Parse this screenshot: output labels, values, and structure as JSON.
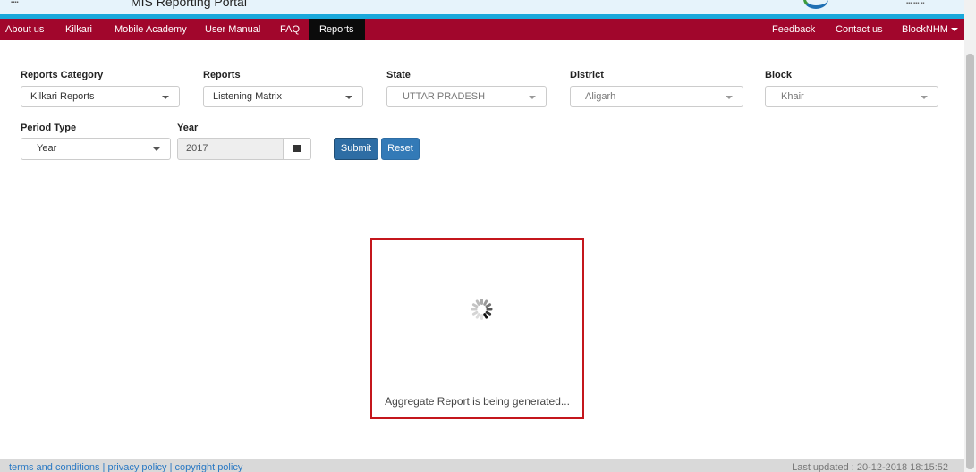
{
  "header": {
    "portal_title": "MIS Reporting Portal"
  },
  "nav": {
    "items": [
      "About us",
      "Kilkari",
      "Mobile Academy",
      "User Manual",
      "FAQ",
      "Reports"
    ],
    "active": "Reports",
    "right_items": [
      "Feedback",
      "Contact us"
    ],
    "user_menu": "BlockNHM"
  },
  "filters": {
    "reports_category": {
      "label": "Reports Category",
      "value": "Kilkari Reports"
    },
    "reports": {
      "label": "Reports",
      "value": "Listening Matrix"
    },
    "state": {
      "label": "State",
      "value": "UTTAR PRADESH"
    },
    "district": {
      "label": "District",
      "value": "Aligarh"
    },
    "block": {
      "label": "Block",
      "value": "Khair"
    },
    "period_type": {
      "label": "Period Type",
      "value": "Year"
    },
    "year": {
      "label": "Year",
      "value": "2017"
    }
  },
  "buttons": {
    "submit": "Submit",
    "reset": "Reset"
  },
  "loader": {
    "message": "Aggregate Report is being generated..."
  },
  "footer": {
    "links": [
      "terms and conditions",
      "privacy policy",
      "copyright policy"
    ],
    "last_updated": "Last updated : 20-12-2018 18:15:52"
  },
  "colors": {
    "nav_bg": "#a1062c",
    "accent_stripe": "#19a8db",
    "button_primary": "#337ab7",
    "loader_border": "#c4161c"
  },
  "icons": {
    "loader": "spinner-icon",
    "calendar": "calendar-icon",
    "dropdown": "chevron-down-icon"
  }
}
